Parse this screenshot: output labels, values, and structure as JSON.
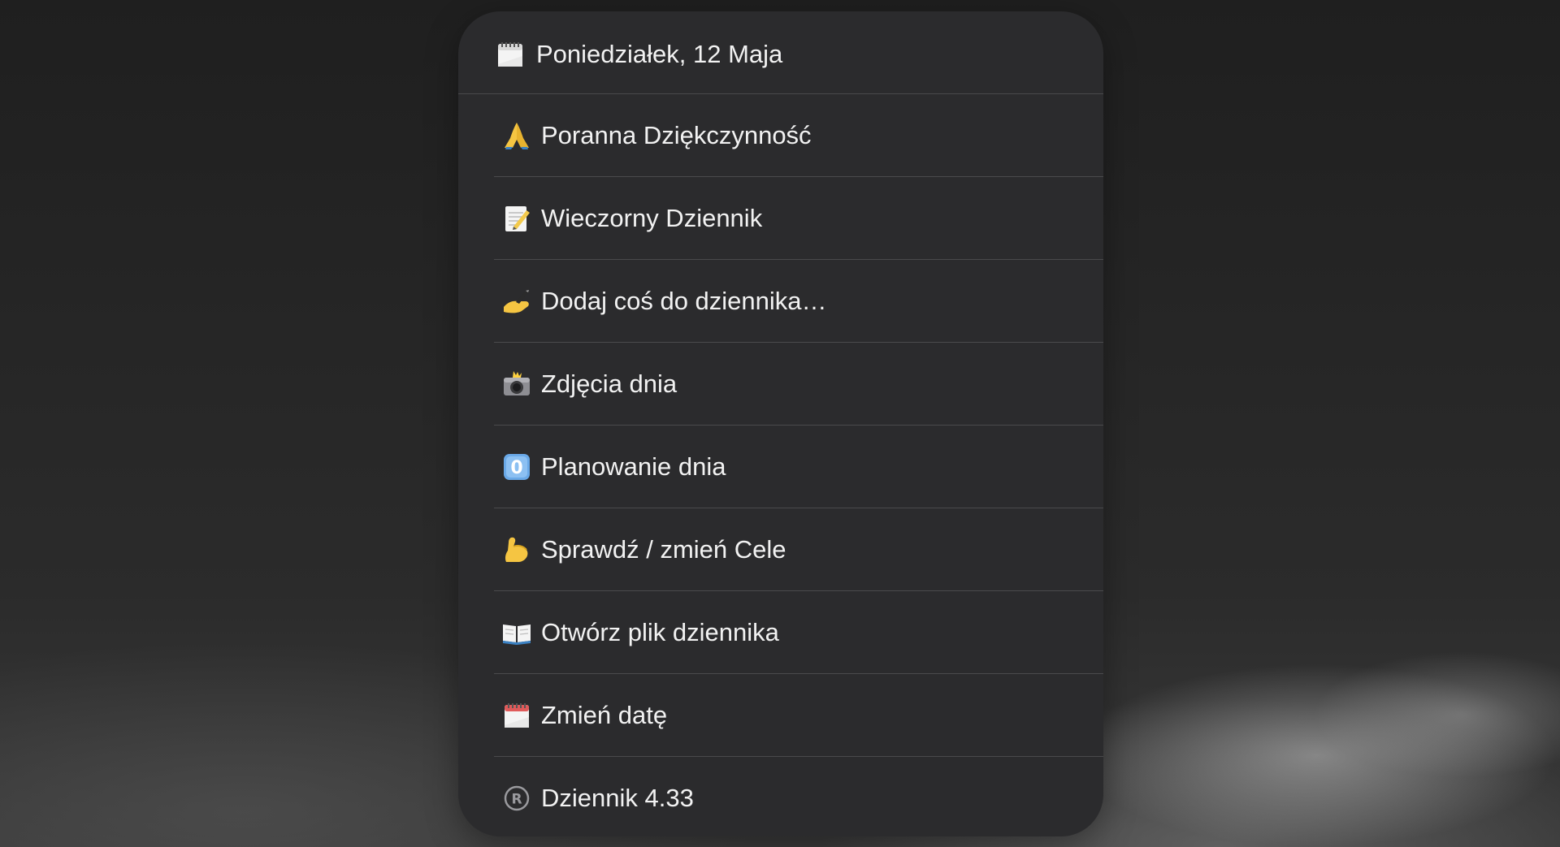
{
  "menu": {
    "header": {
      "icon": "calendar-icon",
      "title": "Poniedziałek, 12 Maja"
    },
    "items": [
      {
        "icon": "folded-hands-icon",
        "label": "Poranna Dziękczynność"
      },
      {
        "icon": "memo-icon",
        "label": "Wieczorny Dziennik"
      },
      {
        "icon": "writing-hand-icon",
        "label": "Dodaj coś do dziennika…"
      },
      {
        "icon": "camera-flash-icon",
        "label": "Zdjęcia dnia"
      },
      {
        "icon": "keycap-zero-icon",
        "label": "Planowanie dnia"
      },
      {
        "icon": "flexed-biceps-icon",
        "label": "Sprawdź / zmień Cele"
      },
      {
        "icon": "open-book-icon",
        "label": "Otwórz plik dziennika"
      },
      {
        "icon": "calendar-icon",
        "label": "Zmień datę"
      },
      {
        "icon": "registered-icon",
        "label": "Dziennik 4.33"
      }
    ]
  },
  "colors": {
    "sheet_background": "#2b2b2d",
    "divider": "#4a4a4c",
    "text": "#f2f2f2"
  }
}
